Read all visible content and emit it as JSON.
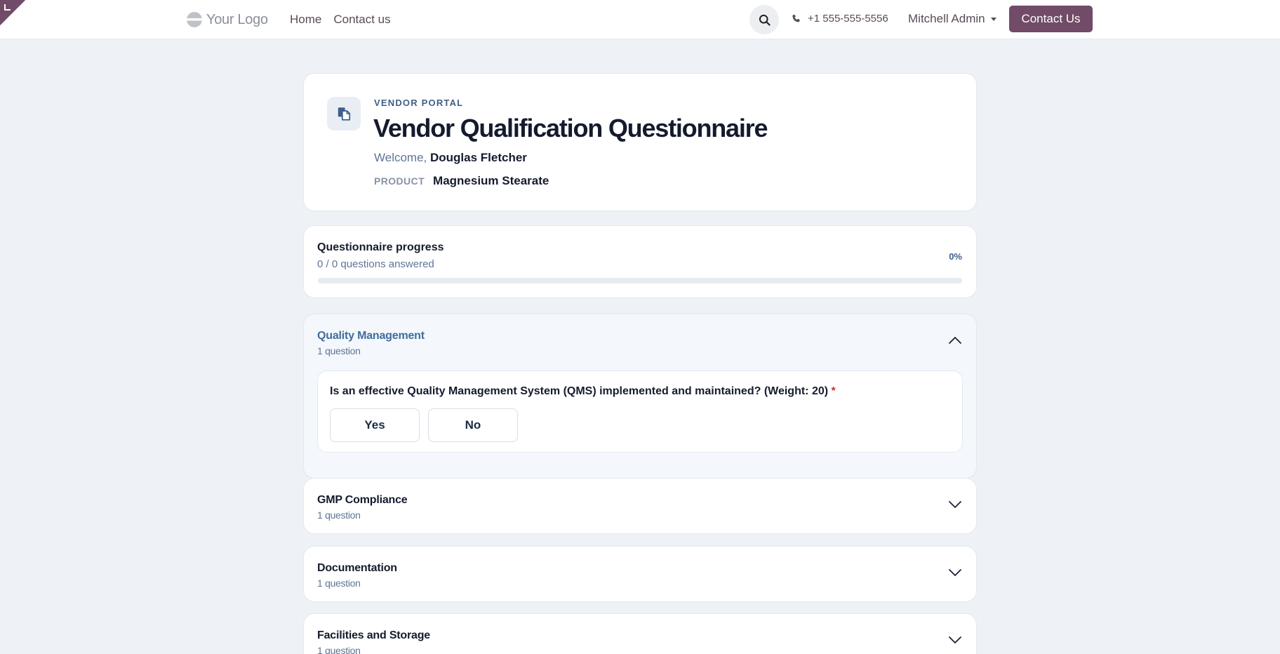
{
  "header": {
    "logo_text": "Your Logo",
    "nav": [
      "Home",
      "Contact us"
    ],
    "phone": "+1 555-555-5556",
    "user": "Mitchell Admin",
    "cta_label": "Contact Us"
  },
  "hero": {
    "eyebrow": "VENDOR PORTAL",
    "title": "Vendor Qualification Questionnaire",
    "welcome_prefix": "Welcome,",
    "welcome_name": "Douglas Fletcher",
    "product_label": "PRODUCT",
    "product_value": "Magnesium Stearate"
  },
  "progress": {
    "title": "Questionnaire progress",
    "subtitle": "0 / 0 questions answered",
    "percent_label": "0%",
    "percent_value": 0
  },
  "sections": [
    {
      "title": "Quality Management",
      "count": "1 question",
      "expanded": true,
      "question": {
        "text": "Is an effective Quality Management System (QMS) implemented and maintained? (Weight: 20)",
        "required_marker": "*",
        "options": [
          "Yes",
          "No"
        ]
      }
    },
    {
      "title": "GMP Compliance",
      "count": "1 question",
      "expanded": false
    },
    {
      "title": "Documentation",
      "count": "1 question",
      "expanded": false
    },
    {
      "title": "Facilities and Storage",
      "count": "1 question",
      "expanded": false
    }
  ],
  "colors": {
    "brand": "#714b67",
    "accent": "#3f6c9c",
    "required": "#c0392b",
    "background": "#eef2f7"
  },
  "icons": {
    "search": "search-icon",
    "phone": "phone-icon",
    "questionnaire": "document-copy-icon",
    "expanded": "chevron-up-icon",
    "collapsed": "chevron-down-icon"
  }
}
